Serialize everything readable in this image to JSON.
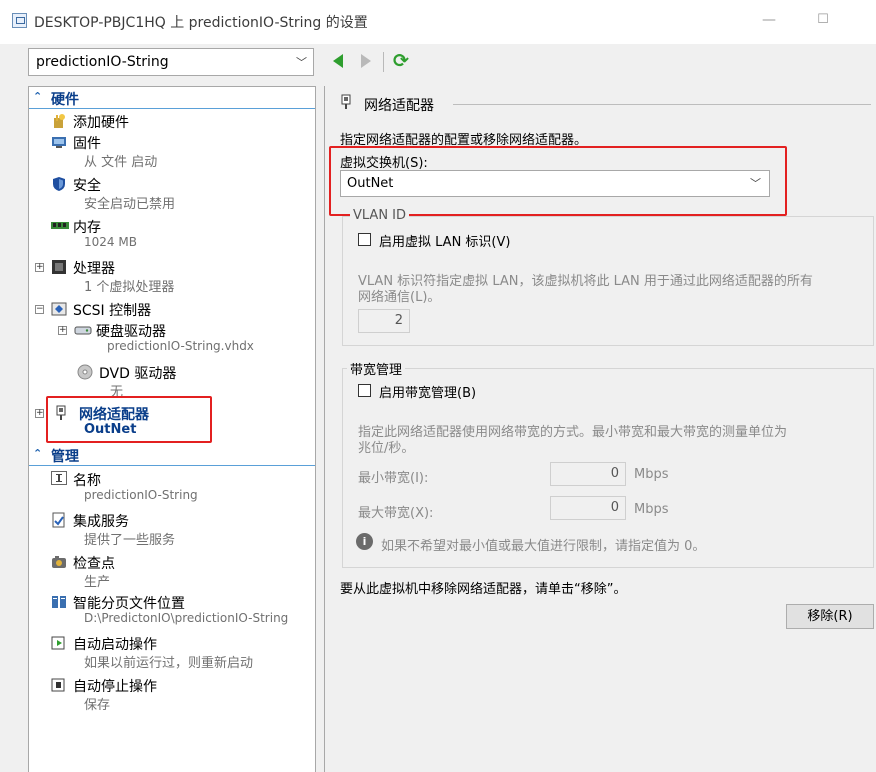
{
  "window": {
    "title": "DESKTOP-PBJC1HQ 上 predictionIO-String 的设置",
    "minimize": "—",
    "maximize": "☐"
  },
  "vm_selector": {
    "value": "predictionIO-String"
  },
  "tree": {
    "hardware_header": "硬件",
    "management_header": "管理",
    "hardware_items": [
      {
        "label": "添加硬件",
        "sub": ""
      },
      {
        "label": "固件",
        "sub": "从 文件 启动"
      },
      {
        "label": "安全",
        "sub": "安全启动已禁用"
      },
      {
        "label": "内存",
        "sub": "1024 MB"
      },
      {
        "label": "处理器",
        "sub": "1 个虚拟处理器"
      },
      {
        "label": "SCSI 控制器",
        "sub": ""
      },
      {
        "label": "硬盘驱动器",
        "sub": "predictionIO-String.vhdx"
      },
      {
        "label": "DVD 驱动器",
        "sub": "无"
      },
      {
        "label": "网络适配器",
        "sub": "OutNet"
      }
    ],
    "management_items": [
      {
        "label": "名称",
        "sub": "predictionIO-String"
      },
      {
        "label": "集成服务",
        "sub": "提供了一些服务"
      },
      {
        "label": "检查点",
        "sub": "生产"
      },
      {
        "label": "智能分页文件位置",
        "sub": "D:\\PredictonIO\\predictionIO-String"
      },
      {
        "label": "自动启动操作",
        "sub": "如果以前运行过，则重新启动"
      },
      {
        "label": "自动停止操作",
        "sub": "保存"
      }
    ]
  },
  "detail": {
    "section_title": "网络适配器",
    "description": "指定网络适配器的配置或移除网络适配器。",
    "switch_label": "虚拟交换机(S):",
    "switch_value": "OutNet",
    "vlan": {
      "title": "VLAN ID",
      "checkbox_label": "启用虚拟 LAN 标识(V)",
      "checked": false,
      "desc_line1": "VLAN 标识符指定虚拟 LAN，该虚拟机将此 LAN 用于通过此网络适配器的所有",
      "desc_line2": "网络通信(L)。",
      "value": "2"
    },
    "bandwidth": {
      "title": "带宽管理",
      "checkbox_label": "启用带宽管理(B)",
      "checked": false,
      "desc_line1": "指定此网络适配器使用网络带宽的方式。最小带宽和最大带宽的测量单位为",
      "desc_line2": "兆位/秒。",
      "min_label": "最小带宽(I):",
      "min_value": "0",
      "max_label": "最大带宽(X):",
      "max_value": "0",
      "unit": "Mbps",
      "info": "如果不希望对最小值或最大值进行限制，请指定值为 0。"
    },
    "remove_hint": "要从此虚拟机中移除网络适配器，请单击“移除”。",
    "remove_button": "移除(R)"
  },
  "colors": {
    "highlight_red": "#e32020",
    "section_blue": "#0a3e8a",
    "nav_green": "#2e9e2e"
  }
}
